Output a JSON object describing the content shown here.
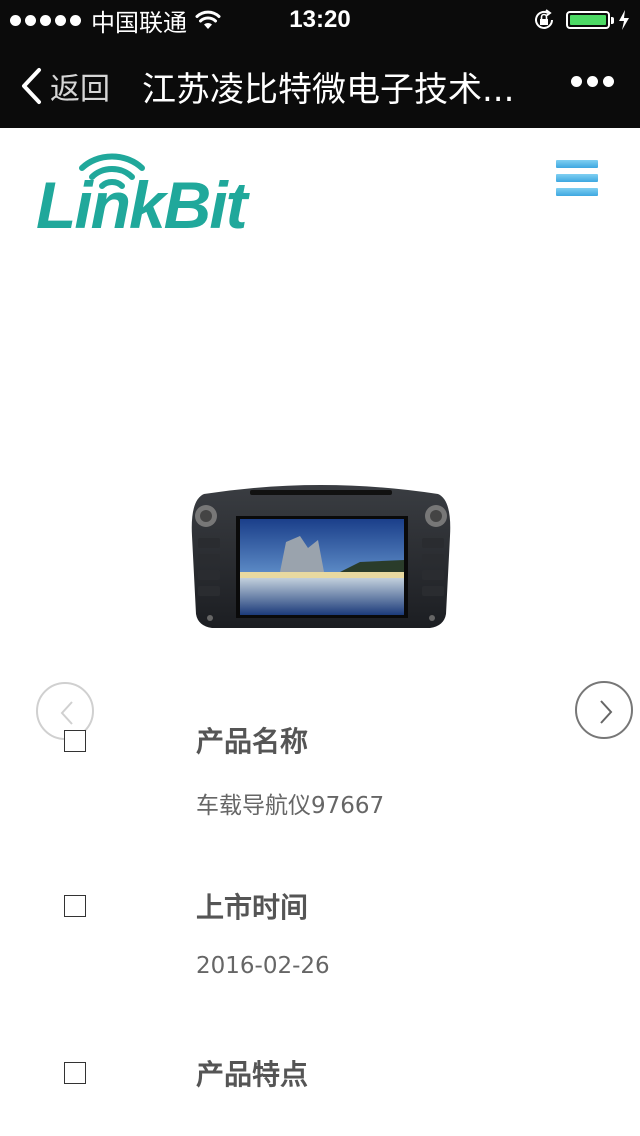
{
  "status_bar": {
    "carrier": "中国联通",
    "time": "13:20",
    "battery_level": 1.0
  },
  "nav": {
    "back_label": "返回",
    "title": "江苏凌比特微电子技术..."
  },
  "header": {
    "logo_text": "LinkBit",
    "menu_icon": "hamburger-icon"
  },
  "colors": {
    "logo": "#20a89b",
    "menu": "#4fb7e6",
    "nav_bg": "#0b0b0b",
    "battery": "#4cd964"
  },
  "product": {
    "image": "car-navigation-unit"
  },
  "info": [
    {
      "label": "产品名称",
      "value": "车载导航仪97667"
    },
    {
      "label": "上市时间",
      "value": "2016-02-26"
    },
    {
      "label": "产品特点",
      "value": ""
    }
  ]
}
